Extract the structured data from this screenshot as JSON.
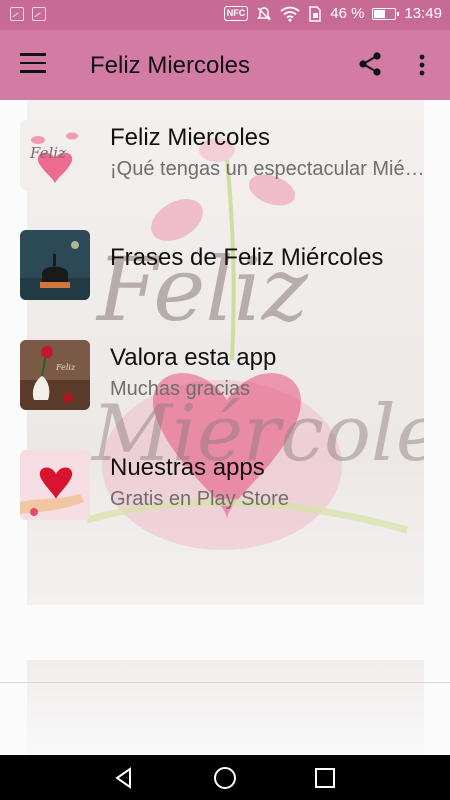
{
  "status_bar": {
    "battery": "46 %",
    "battery_level": 0.46,
    "time": "13:49",
    "nfc_label": "NFC",
    "icons": [
      "gallery-icon",
      "image-icon",
      "nfc-icon",
      "mute-icon",
      "wifi-icon",
      "sim-icon",
      "battery-icon"
    ]
  },
  "app_bar": {
    "title": "Feliz Miercoles",
    "background": "#d27ba3",
    "icons": [
      "menu-icon",
      "share-icon",
      "more-vert-icon"
    ]
  },
  "list": [
    {
      "title": "Feliz Miercoles",
      "subtitle": "¡Qué tengas un espectacular Miércoles!",
      "thumb": "feliz-miercoles-heart-thumb"
    },
    {
      "title": "Frases de Feliz Miércoles",
      "subtitle": "",
      "thumb": "mosque-night-thumb"
    },
    {
      "title": "Valora esta app",
      "subtitle": "Muchas gracias",
      "thumb": "rose-vase-thumb"
    },
    {
      "title": "Nuestras apps",
      "subtitle": "Gratis en Play Store",
      "thumb": "heart-hand-thumb"
    }
  ],
  "nav_bar": {
    "icons": [
      "back-icon",
      "home-icon",
      "recents-icon"
    ]
  },
  "colors": {
    "status_bar": "#c76b95",
    "app_bar": "#d27ba3",
    "heart": "#e8527f"
  }
}
